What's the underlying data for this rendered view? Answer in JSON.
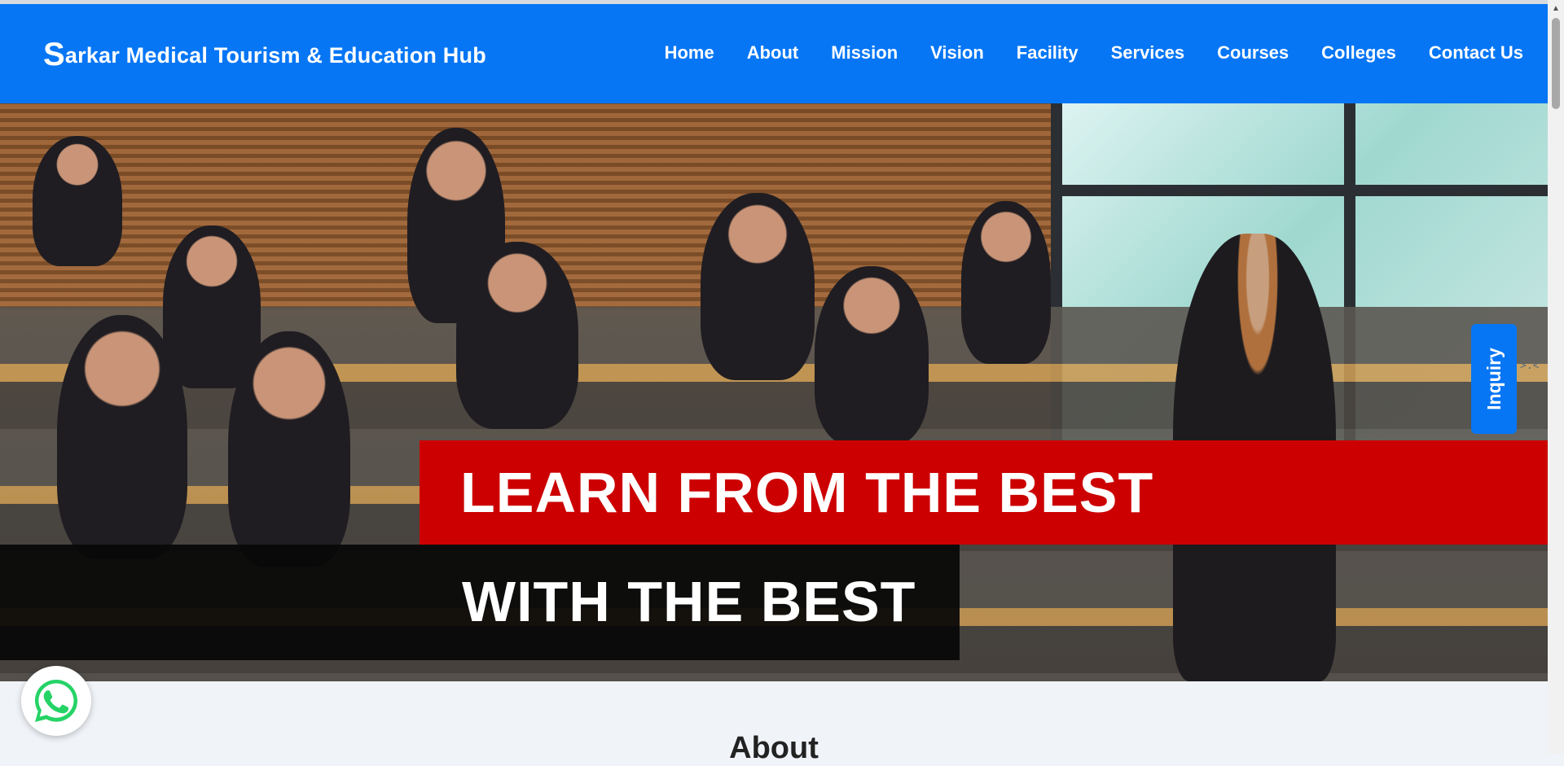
{
  "brand": {
    "cap": "S",
    "rest": "arkar Medical Tourism & Education Hub"
  },
  "nav": {
    "home": "Home",
    "about": "About",
    "mission": "Mission",
    "vision": "Vision",
    "facility": "Facility",
    "services": "Services",
    "courses": "Courses",
    "colleges": "Colleges",
    "contact": "Contact Us"
  },
  "hero": {
    "line1": "LEARN FROM THE BEST",
    "line2": "WITH THE BEST"
  },
  "inquiry": {
    "label": "Inquiry",
    "handle": ">.<"
  },
  "about": {
    "title": "About"
  },
  "colors": {
    "primary": "#0676f5",
    "banner_red": "#cc0000",
    "banner_dark": "#080808",
    "page_bg": "#f0f3f8",
    "whatsapp_green": "#25d366"
  },
  "icons": {
    "whatsapp": "whatsapp-icon",
    "scroll_up": "chevron-up-icon"
  }
}
